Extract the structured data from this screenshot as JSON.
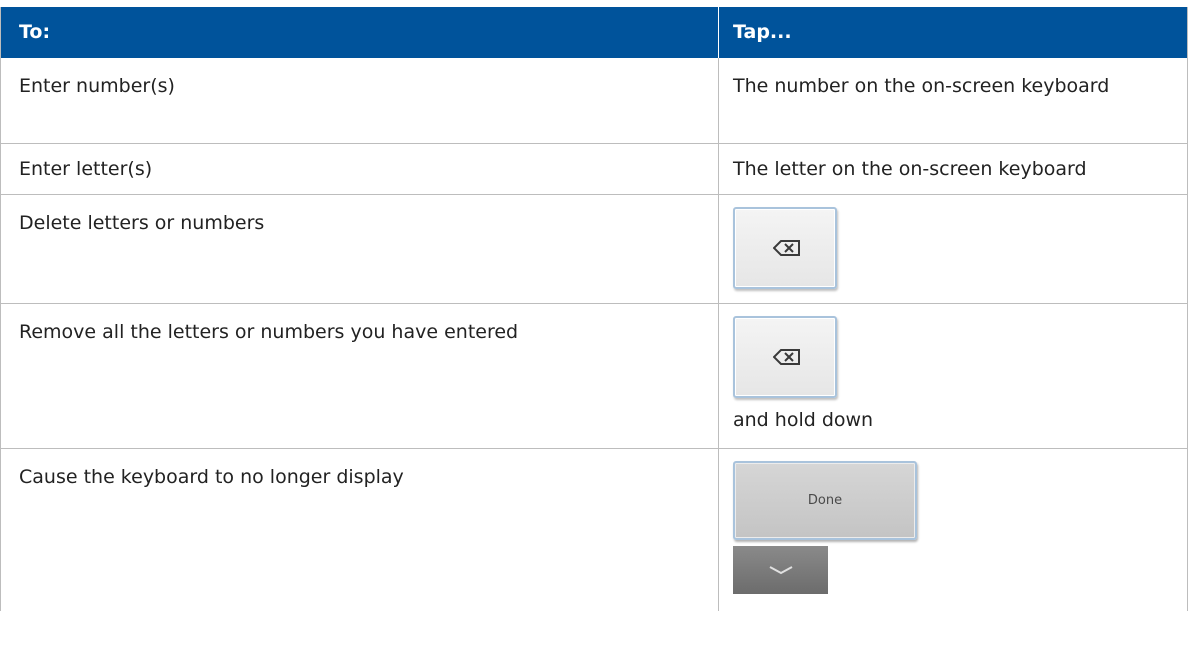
{
  "table": {
    "headers": {
      "to": "To:",
      "tap": "Tap..."
    },
    "rows": [
      {
        "action": "Enter number(s)",
        "tap": "The number on the on-screen keyboard"
      },
      {
        "action": "Enter letter(s)",
        "tap": "The letter on the on-screen keyboard"
      },
      {
        "action": "Delete letters or numbers",
        "tap_icon": "backspace-key"
      },
      {
        "action": "Remove all the letters or numbers you have entered",
        "tap_icon": "backspace-key",
        "tap_note": "and hold down"
      },
      {
        "action": "Cause the keyboard to no longer display",
        "tap_button": "Done",
        "tap_icon2": "chevron-down-key"
      }
    ]
  },
  "colors": {
    "header_bg": "#00539b",
    "header_text": "#ffffff",
    "border": "#bdbdbd"
  }
}
